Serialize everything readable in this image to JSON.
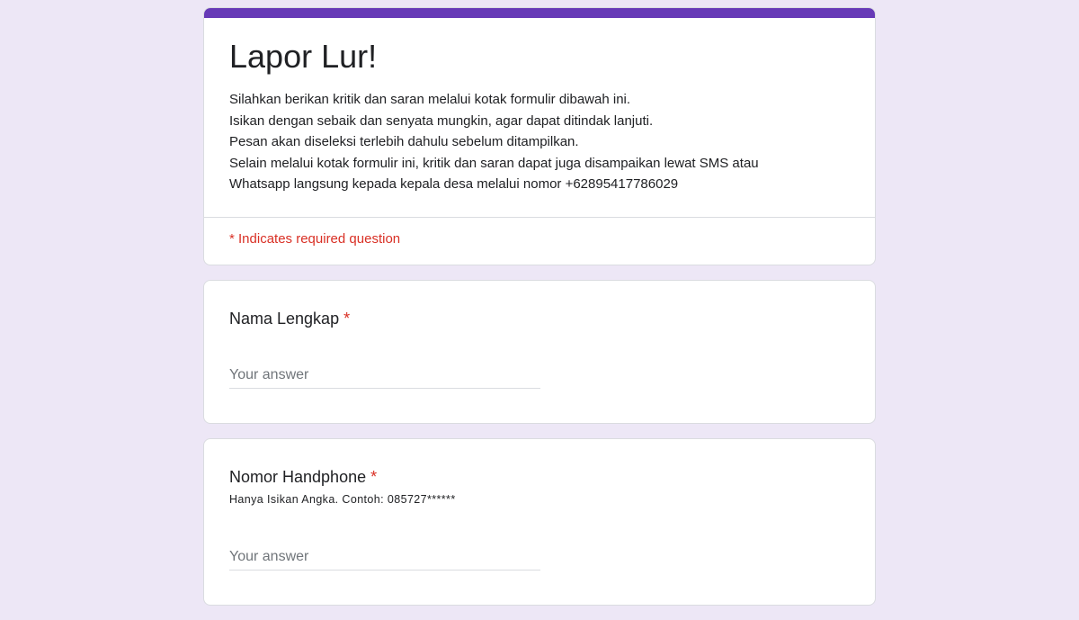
{
  "form": {
    "title": "Lapor Lur!",
    "description_lines": [
      "Silahkan berikan kritik dan saran melalui kotak formulir dibawah ini.",
      "Isikan dengan sebaik dan senyata mungkin, agar dapat ditindak lanjuti.",
      "Pesan akan diseleksi terlebih dahulu sebelum ditampilkan.",
      "Selain melalui kotak formulir ini, kritik dan saran dapat juga disampaikan lewat SMS atau",
      "Whatsapp langsung kepada kepala desa melalui nomor +62895417786029"
    ],
    "required_note": "* Indicates required question",
    "accent_color": "#673ab7",
    "background_color": "#ede7f6",
    "required_color": "#d93025"
  },
  "questions": [
    {
      "title": "Nama Lengkap",
      "required_mark": "*",
      "help": "",
      "placeholder": "Your answer"
    },
    {
      "title": "Nomor Handphone",
      "required_mark": "*",
      "help": "Hanya Isikan Angka. Contoh: 085727******",
      "placeholder": "Your answer"
    }
  ]
}
